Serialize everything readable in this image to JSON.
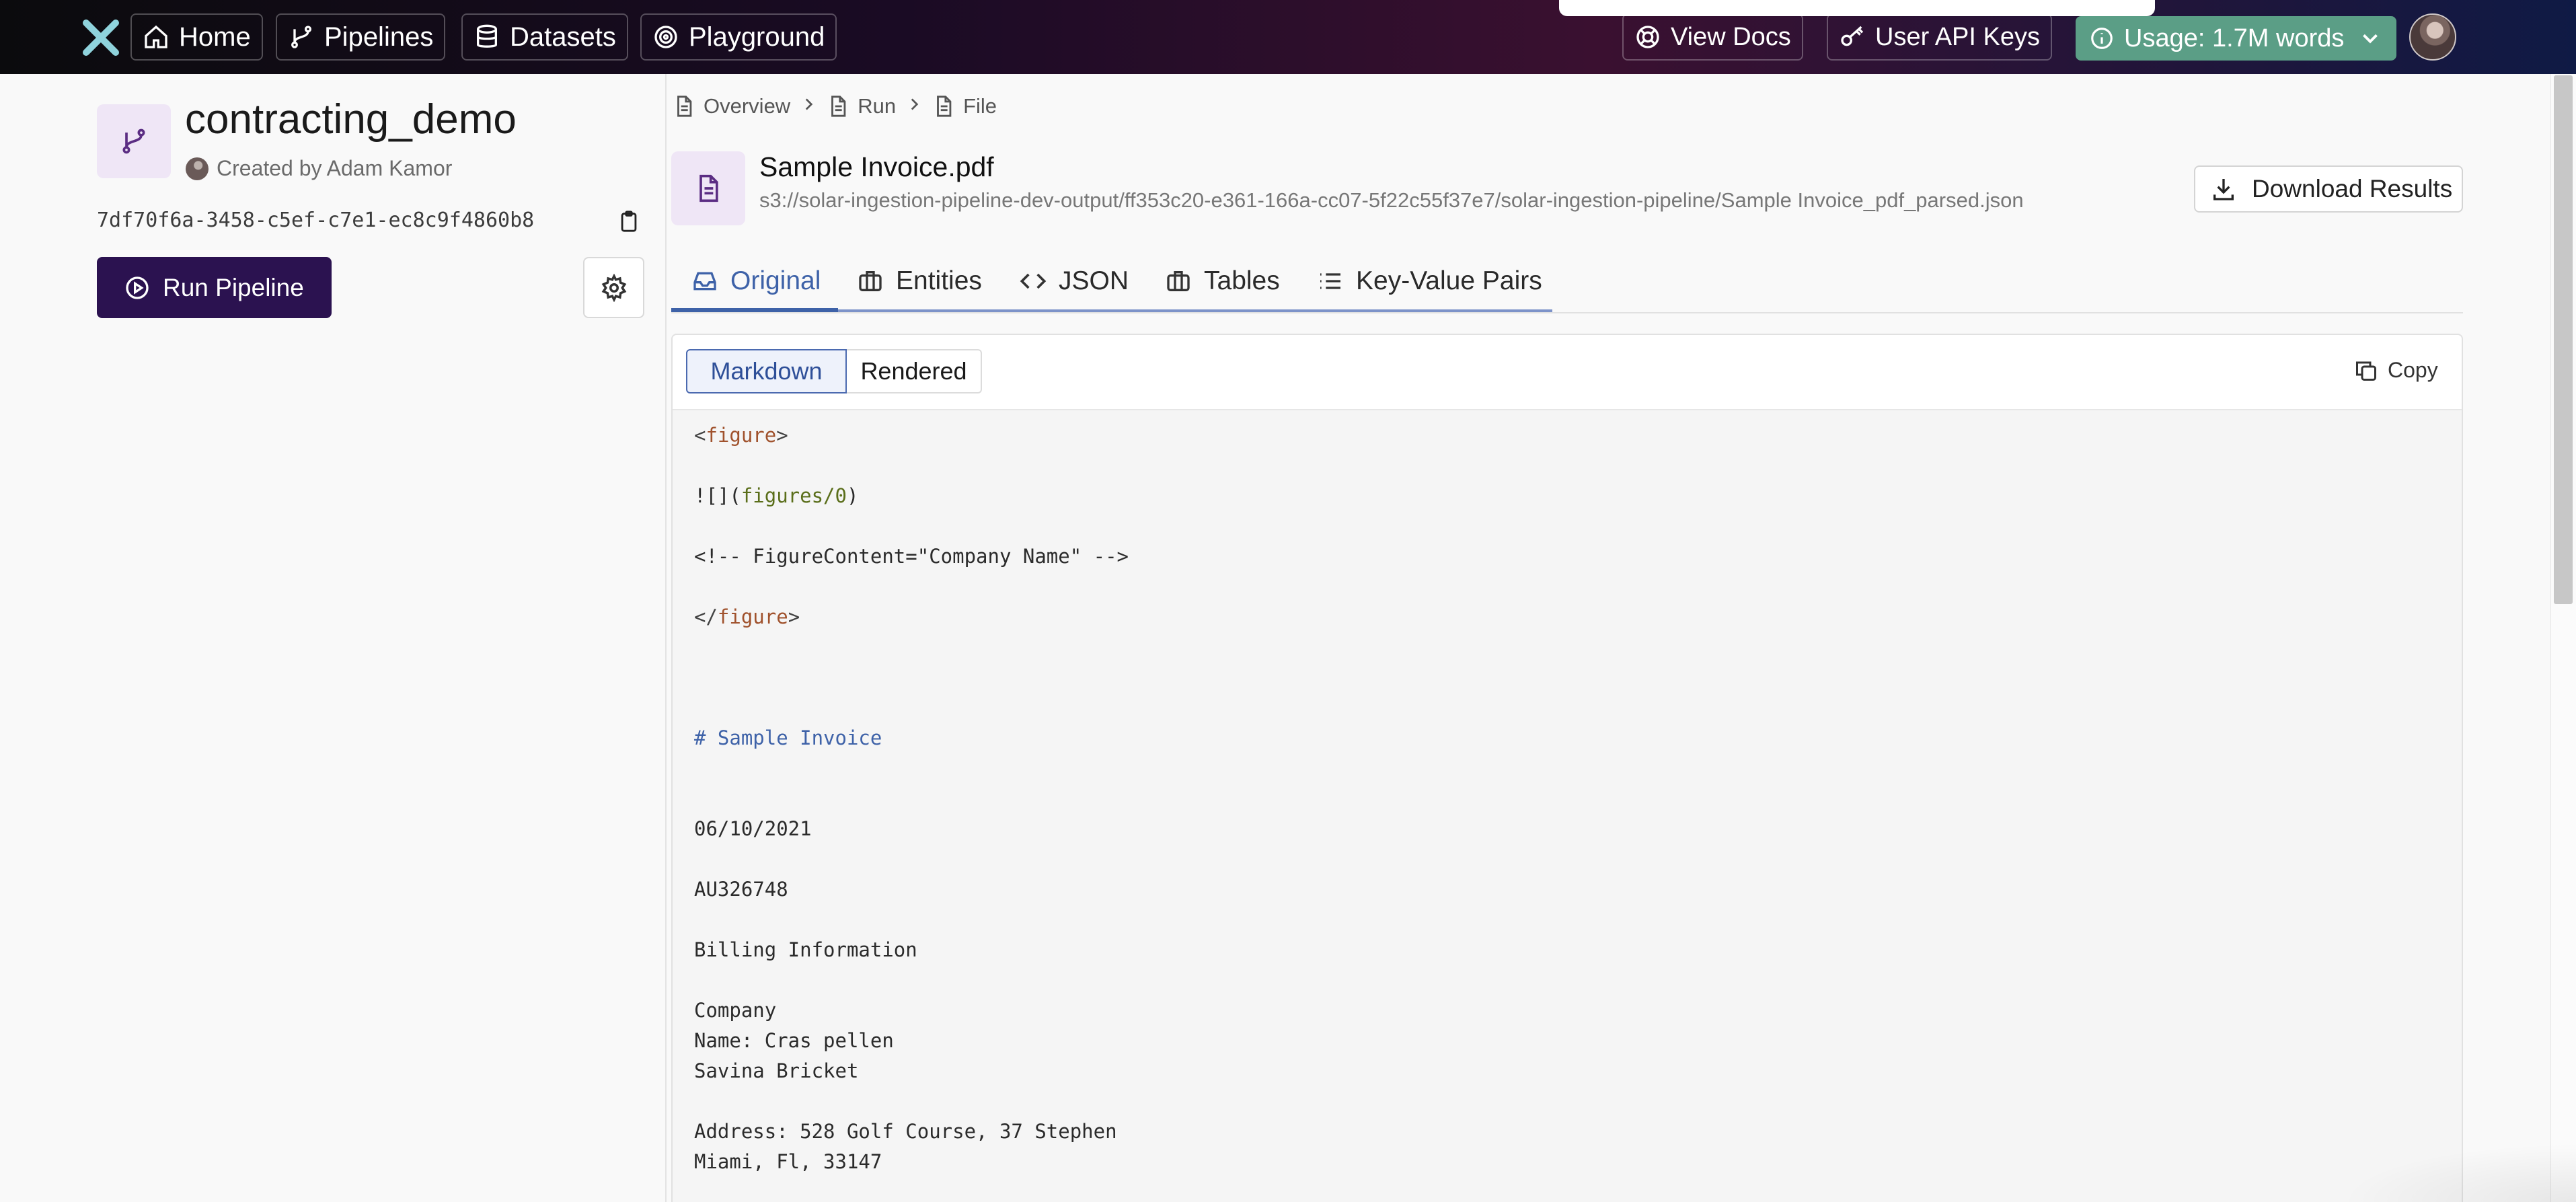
{
  "nav": {
    "home_label": "Home",
    "pipelines_label": "Pipelines",
    "datasets_label": "Datasets",
    "playground_label": "Playground",
    "view_docs_label": "View Docs",
    "api_keys_label": "User API Keys",
    "usage_label": "Usage: 1.7M words"
  },
  "pipeline": {
    "name": "contracting_demo",
    "created_by": "Created by Adam Kamor",
    "id": "7df70f6a-3458-c5ef-c7e1-ec8c9f4860b8",
    "run_label": "Run Pipeline"
  },
  "breadcrumb": {
    "overview": "Overview",
    "run": "Run",
    "file": "File"
  },
  "file": {
    "name": "Sample Invoice.pdf",
    "path": "s3://solar-ingestion-pipeline-dev-output/ff353c20-e361-166a-cc07-5f22c55f37e7/solar-ingestion-pipeline/Sample Invoice_pdf_parsed.json",
    "download_label": "Download Results"
  },
  "tabs": {
    "original": "Original",
    "entities": "Entities",
    "json": "JSON",
    "tables": "Tables",
    "kv": "Key-Value Pairs"
  },
  "view_toggle": {
    "markdown": "Markdown",
    "rendered": "Rendered",
    "copy": "Copy"
  },
  "code": {
    "l1_open": "<",
    "l1_tag": "figure",
    "l1_close": ">",
    "l2_pre": "![](",
    "l2_link": "figures/0",
    "l2_post": ")",
    "l3": "<!-- FigureContent=\"Company Name\" -->",
    "l4_open": "</",
    "l4_tag": "figure",
    "l4_close": ">",
    "l5": "# Sample Invoice",
    "l6": "06/10/2021",
    "l7": "AU326748",
    "l8": "Billing Information",
    "l9": "Company",
    "l10": "Name: Cras pellen",
    "l11": "Savina Bricket",
    "l12": "Address: 528 Golf Course, 37 Stephen",
    "l13": "Miami, Fl, 33147"
  },
  "colors": {
    "accent": "#3e62a8",
    "run_button": "#2b1250",
    "usage_badge": "#5b9e86"
  },
  "icons": [
    "x-logo-icon",
    "home-icon",
    "branch-icon",
    "database-icon",
    "target-icon",
    "lifebuoy-icon",
    "key-icon",
    "info-icon",
    "chevron-down-icon",
    "clipboard-icon",
    "play-circle-icon",
    "gear-icon",
    "document-icon",
    "chevron-right-icon",
    "download-icon",
    "inbox-icon",
    "briefcase-icon",
    "code-icon",
    "list-icon",
    "copy-icon"
  ]
}
